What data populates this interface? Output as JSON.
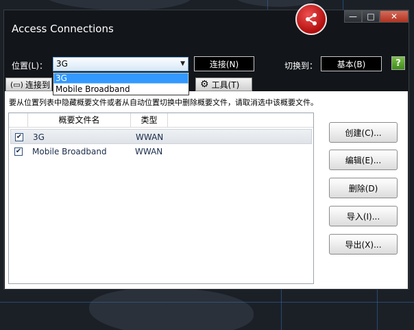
{
  "window": {
    "title": "Access Connections",
    "minimize": "—",
    "maximize": "□",
    "close": "✕",
    "logo_icon": "share-icon"
  },
  "toolbar": {
    "location_label": "位置(L)：",
    "location_value": "3G",
    "dropdown_options": [
      "3G",
      "Mobile Broadband"
    ],
    "connect_label": "连接(N)",
    "switch_to_label": "切换到：",
    "basic_label": "基本(B)",
    "help_icon": "help-icon"
  },
  "tabs": {
    "connect_label": "连接到",
    "tools_label": "工具(T)"
  },
  "panel": {
    "hint": "要从位置列表中隐藏概要文件或者从自动位置切换中删除概要文件，请取消选中该概要文件。",
    "columns": [
      "概要文件名",
      "类型"
    ],
    "rows": [
      {
        "name": "3G",
        "type": "WWAN",
        "checked": true
      },
      {
        "name": "Mobile Broadband",
        "type": "WWAN",
        "checked": true
      }
    ],
    "buttons": {
      "create": "创建(C)...",
      "edit": "编辑(E)...",
      "delete": "删除(D)",
      "import": "导入(I)...",
      "export": "导出(X)..."
    }
  }
}
